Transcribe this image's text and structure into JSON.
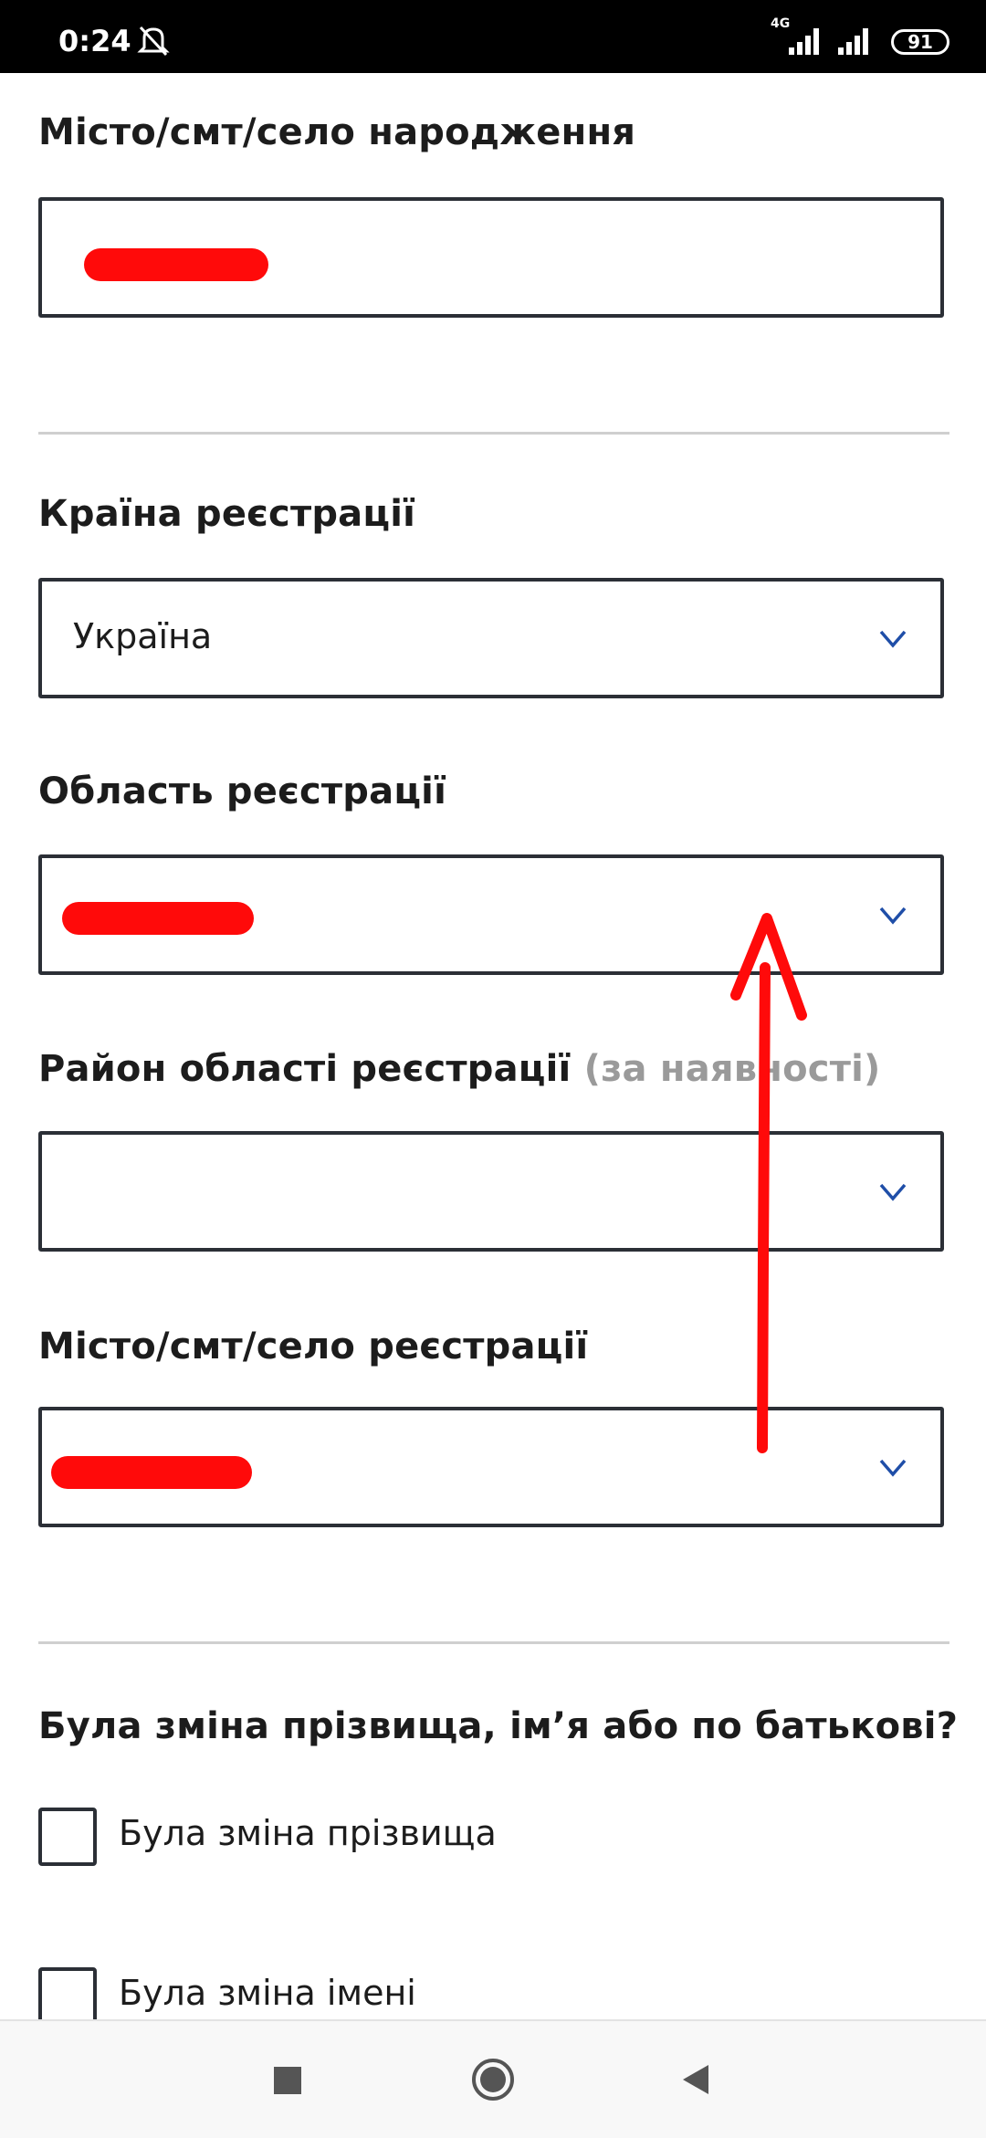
{
  "status_bar": {
    "time": "0:24",
    "battery": "91",
    "network": "4G"
  },
  "form": {
    "birth_city": {
      "label": "Місто/смт/село народження",
      "value": ""
    },
    "reg_country": {
      "label": "Країна реєстрації",
      "value": "Україна"
    },
    "reg_region": {
      "label": "Область реєстрації",
      "value": ""
    },
    "reg_district": {
      "label": "Район області реєстрації",
      "label_hint": "(за наявності)",
      "value": ""
    },
    "reg_city": {
      "label": "Місто/смт/село реєстрації",
      "value": ""
    },
    "name_change": {
      "question": "Була зміна прізвища, імʼя або по батькові?",
      "options": [
        "Була зміна прізвища",
        "Була зміна імені"
      ]
    }
  },
  "colors": {
    "accent": "#1f4ea8",
    "border": "#2b2f36",
    "redaction": "#ff0a0a",
    "annotation": "#ff0a0a"
  },
  "icons": {
    "mute": "bell-slash-icon",
    "chevron": "chevron-down-icon",
    "nav": [
      "recents-square-icon",
      "home-circle-icon",
      "back-triangle-icon"
    ]
  }
}
